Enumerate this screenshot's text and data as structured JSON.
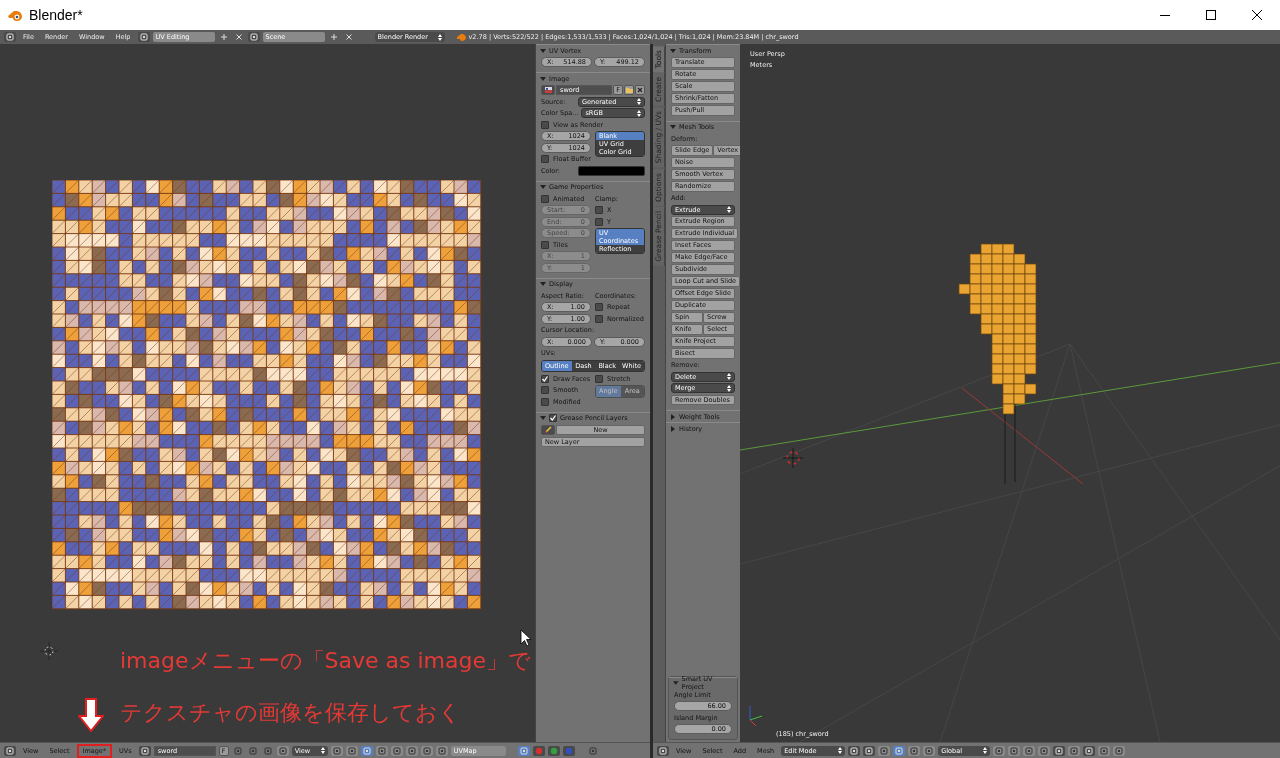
{
  "window": {
    "title": "Blender*"
  },
  "info_header": {
    "menus": [
      "File",
      "Render",
      "Window",
      "Help"
    ],
    "screen_layout": "UV Editing",
    "scene": "Scene",
    "render_engine": "Blender Render",
    "stats": "v2.78 | Verts:522/522 | Edges:1,533/1,533 | Faces:1,024/1,024 | Tris:1,024 | Mem:23.84M | chr_sword"
  },
  "properties": {
    "panels": [
      {
        "title": "UV Vertex",
        "expanded": true,
        "rows": [
          {
            "kind": "numbers",
            "fields": [
              {
                "label": "X:",
                "value": "514.88"
              },
              {
                "label": "Y:",
                "value": "499.12"
              }
            ]
          }
        ]
      },
      {
        "title": "Image",
        "expanded": true,
        "rows": [
          {
            "kind": "image",
            "value": "sword",
            "button": "F"
          },
          {
            "kind": "select",
            "label": "Source:",
            "value": "Generated"
          },
          {
            "kind": "select",
            "label": "Color Spa...",
            "value": "sRGB"
          },
          {
            "kind": "check",
            "label": "View as Render",
            "checked": false
          },
          {
            "kind": "columns",
            "columns": [
              [
                {
                  "kind": "number",
                  "label": "X:",
                  "value": "1024"
                },
                {
                  "kind": "number",
                  "label": "Y:",
                  "value": "1024"
                },
                {
                  "kind": "check",
                  "label": "Float Buffer",
                  "checked": false
                }
              ],
              [
                {
                  "kind": "stack",
                  "items": [
                    {
                      "label": "Blank",
                      "selected": true
                    },
                    {
                      "label": "UV Grid",
                      "selected": false
                    },
                    {
                      "label": "Color Grid",
                      "selected": false
                    }
                  ]
                }
              ]
            ]
          },
          {
            "kind": "color",
            "label": "Color:",
            "color": "#000000"
          }
        ]
      },
      {
        "title": "Game Properties",
        "expanded": true,
        "rows": [
          {
            "kind": "columns",
            "columns": [
              [
                {
                  "kind": "check",
                  "label": "Animated",
                  "checked": false
                },
                {
                  "kind": "number",
                  "label": "Start:",
                  "value": "0",
                  "disabled": true
                },
                {
                  "kind": "number",
                  "label": "End:",
                  "value": "0",
                  "disabled": true
                },
                {
                  "kind": "number",
                  "label": "Speed:",
                  "value": "0",
                  "disabled": true
                },
                {
                  "kind": "check",
                  "label": "Tiles",
                  "checked": false
                },
                {
                  "kind": "number",
                  "label": "X:",
                  "value": "1",
                  "disabled": true
                },
                {
                  "kind": "number",
                  "label": "Y:",
                  "value": "1",
                  "disabled": true
                }
              ],
              [
                {
                  "kind": "heading",
                  "label": "Clamp:"
                },
                {
                  "kind": "check",
                  "label": "X",
                  "checked": false
                },
                {
                  "kind": "check",
                  "label": "Y",
                  "checked": false
                },
                {
                  "kind": "stack",
                  "items": [
                    {
                      "label": "UV Coordinates",
                      "selected": true
                    },
                    {
                      "label": "Reflection",
                      "selected": false
                    }
                  ]
                }
              ]
            ]
          }
        ]
      },
      {
        "title": "Display",
        "expanded": true,
        "rows": [
          {
            "kind": "columns",
            "columns": [
              [
                {
                  "kind": "heading",
                  "label": "Aspect Ratio:"
                },
                {
                  "kind": "number",
                  "label": "X:",
                  "value": "1.00"
                },
                {
                  "kind": "number",
                  "label": "Y:",
                  "value": "1.00"
                }
              ],
              [
                {
                  "kind": "heading",
                  "label": "Coordinates:"
                },
                {
                  "kind": "check",
                  "label": "Repeat",
                  "checked": false
                },
                {
                  "kind": "check",
                  "label": "Normalized",
                  "checked": false
                }
              ]
            ]
          },
          {
            "kind": "heading",
            "label": "Cursor Location:"
          },
          {
            "kind": "numbers",
            "fields": [
              {
                "label": "X:",
                "value": "0.000"
              },
              {
                "label": "Y:",
                "value": "0.000"
              }
            ]
          },
          {
            "kind": "heading",
            "label": "UVs:"
          },
          {
            "kind": "segmented",
            "items": [
              {
                "label": "Outline",
                "selected": true
              },
              {
                "label": "Dash",
                "selected": false
              },
              {
                "label": "Black",
                "selected": false
              },
              {
                "label": "White",
                "selected": false
              }
            ]
          },
          {
            "kind": "columns",
            "columns": [
              [
                {
                  "kind": "check",
                  "label": "Draw Faces",
                  "checked": true
                },
                {
                  "kind": "check",
                  "label": "Smooth",
                  "checked": false
                },
                {
                  "kind": "check",
                  "label": "Modified",
                  "checked": false
                }
              ],
              [
                {
                  "kind": "check",
                  "label": "Stretch",
                  "checked": false
                },
                {
                  "kind": "segmented",
                  "disabled": true,
                  "items": [
                    {
                      "label": "Angle",
                      "selected": true
                    },
                    {
                      "label": "Area",
                      "selected": false
                    }
                  ]
                }
              ]
            ]
          }
        ]
      },
      {
        "title": "Grease Pencil Layers",
        "expanded": true,
        "checked": true,
        "rows": [
          {
            "kind": "pencil",
            "label": "New"
          },
          {
            "kind": "button",
            "label": "New Layer"
          }
        ]
      }
    ]
  },
  "tool_tabs": [
    {
      "label": "Tools",
      "selected": true
    },
    {
      "label": "Create",
      "selected": false
    },
    {
      "label": "Shading / UVs",
      "selected": false
    },
    {
      "label": "Options",
      "selected": false
    },
    {
      "label": "Grease Pencil",
      "selected": false
    }
  ],
  "tool_shelf": {
    "panels": [
      {
        "title": "Transform",
        "expanded": true,
        "rows": [
          {
            "kind": "button",
            "label": "Translate"
          },
          {
            "kind": "button",
            "label": "Rotate"
          },
          {
            "kind": "button",
            "label": "Scale"
          },
          {
            "kind": "button",
            "label": "Shrink/Fatten"
          },
          {
            "kind": "button",
            "label": "Push/Pull"
          }
        ]
      },
      {
        "title": "Mesh Tools",
        "expanded": true,
        "rows": [
          {
            "kind": "heading",
            "label": "Deform:"
          },
          {
            "kind": "buttons",
            "items": [
              "Slide Edge",
              "Vertex"
            ]
          },
          {
            "kind": "button",
            "label": "Noise"
          },
          {
            "kind": "button",
            "label": "Smooth Vertex"
          },
          {
            "kind": "button",
            "label": "Randomize"
          },
          {
            "kind": "heading",
            "label": "Add:"
          },
          {
            "kind": "select",
            "value": "Extrude"
          },
          {
            "kind": "button",
            "label": "Extrude Region"
          },
          {
            "kind": "button",
            "label": "Extrude Individual"
          },
          {
            "kind": "button",
            "label": "Inset Faces"
          },
          {
            "kind": "button",
            "label": "Make Edge/Face"
          },
          {
            "kind": "button",
            "label": "Subdivide"
          },
          {
            "kind": "button",
            "label": "Loop Cut and Slide"
          },
          {
            "kind": "button",
            "label": "Offset Edge Slide"
          },
          {
            "kind": "button",
            "label": "Duplicate"
          },
          {
            "kind": "buttons",
            "items": [
              "Spin",
              "Screw"
            ]
          },
          {
            "kind": "buttons",
            "items": [
              "Knife",
              "Select"
            ]
          },
          {
            "kind": "button",
            "label": "Knife Project"
          },
          {
            "kind": "button",
            "label": "Bisect"
          },
          {
            "kind": "heading",
            "label": "Remove:"
          },
          {
            "kind": "select",
            "value": "Delete"
          },
          {
            "kind": "select",
            "value": "Merge"
          },
          {
            "kind": "button",
            "label": "Remove Doubles"
          }
        ]
      },
      {
        "title": "Weight Tools",
        "expanded": false
      },
      {
        "title": "History",
        "expanded": false
      }
    ]
  },
  "operator_panel": {
    "title": "Smart UV Project",
    "expanded": true,
    "rows": [
      {
        "kind": "heading",
        "label": "Angle Limit"
      },
      {
        "kind": "number",
        "value": "66.00"
      },
      {
        "kind": "heading",
        "label": "Island Margin"
      },
      {
        "kind": "number",
        "value": "0.00"
      }
    ]
  },
  "viewport": {
    "view_name": "User Persp",
    "units": "Meters",
    "object": "(185) chr_sword"
  },
  "uv_header": {
    "menus": [
      {
        "label": "View",
        "highlighted": false
      },
      {
        "label": "Select",
        "highlighted": false
      },
      {
        "label": "Image*",
        "highlighted": true
      },
      {
        "label": "UVs",
        "highlighted": false
      }
    ],
    "image": "sword",
    "fake_user": "F",
    "view_mode": "View",
    "uv_map": "UVMap"
  },
  "view3d_header": {
    "menus": [
      "View",
      "Select",
      "Add",
      "Mesh"
    ],
    "mode": "Edit Mode",
    "orientation": "Global"
  },
  "annotation": {
    "lines": [
      "imageメニューの「Save as image」で",
      "テクスチャの画像を保存しておく"
    ]
  }
}
